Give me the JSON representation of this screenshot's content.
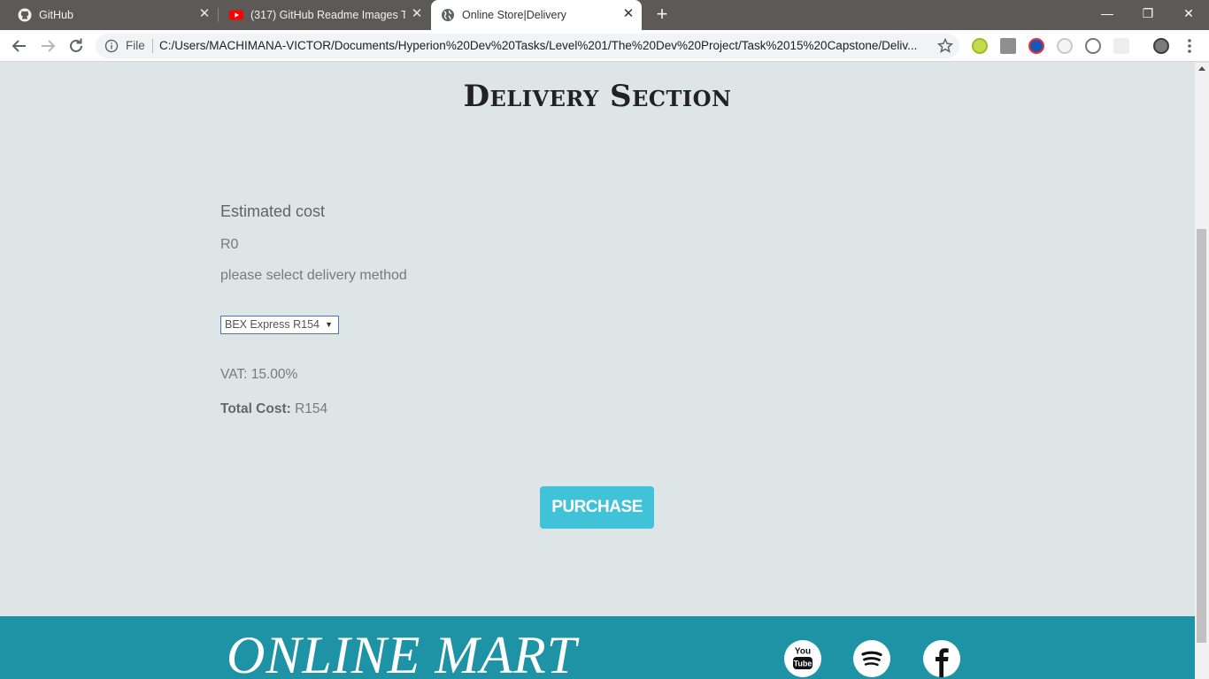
{
  "browser": {
    "tabs": [
      {
        "title": "GitHub",
        "icon": "github-icon"
      },
      {
        "title": "(317) GitHub Readme Images Tut",
        "icon": "youtube-icon"
      },
      {
        "title": "Online Store|Delivery",
        "icon": "globe-icon",
        "active": true
      }
    ],
    "window_controls": {
      "minimize": "—",
      "restore": "❐",
      "close": "✕"
    },
    "address": {
      "scheme_label": "File",
      "url": "C:/Users/MACHIMANA-VICTOR/Documents/Hyperion%20Dev%20Tasks/Level%201/The%20Dev%20Project/Task%2015%20Capstone/Deliv..."
    }
  },
  "page": {
    "title": "Delivery Section",
    "estimate": {
      "heading": "Estimated cost",
      "value": "R0",
      "hint": "please select delivery method"
    },
    "delivery_select": {
      "selected": "BEX Express R154"
    },
    "vat": "VAT: 15.00%",
    "total": {
      "label": "Total Cost:",
      "value": "R154"
    },
    "purchase_label": "PURCHASE"
  },
  "footer": {
    "brand": "ONLINE MART",
    "social": [
      {
        "name": "youtube",
        "text": "You Tube"
      },
      {
        "name": "spotify"
      },
      {
        "name": "facebook"
      }
    ]
  },
  "colors": {
    "page_bg": "#dde5e7",
    "button": "#40c3d9",
    "footer": "#1e93a6",
    "tabstrip": "#5d5957"
  }
}
